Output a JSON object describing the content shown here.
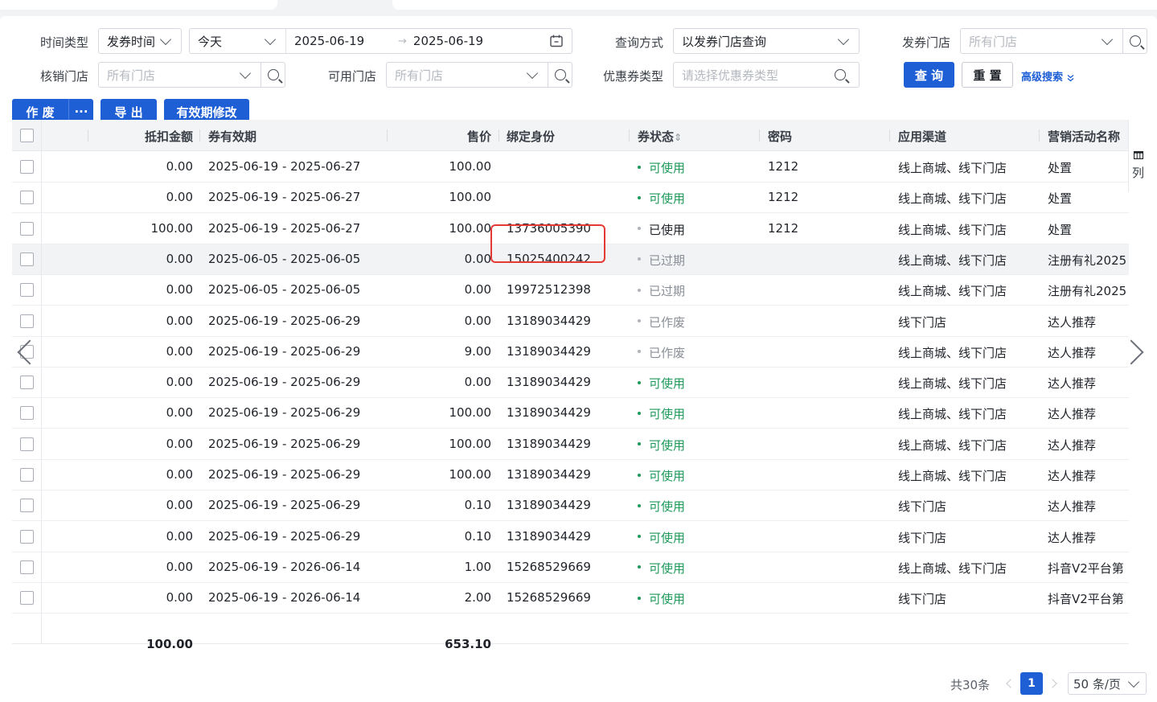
{
  "filters": {
    "time_type_label": "时间类型",
    "time_type_value": "发券时间",
    "range_value": "今天",
    "date_start": "2025-06-19",
    "date_arrow": "→",
    "date_end": "2025-06-19",
    "query_mode_label": "查询方式",
    "query_mode_value": "以发券门店查询",
    "issue_store_label": "发券门店",
    "issue_store_placeholder": "所有门店",
    "verify_store_label": "核销门店",
    "verify_store_placeholder": "所有门店",
    "usable_store_label": "可用门店",
    "usable_store_placeholder": "所有门店",
    "coupon_type_label": "优惠券类型",
    "coupon_type_placeholder": "请选择优惠券类型",
    "search_button": "查 询",
    "reset_button": "重 置",
    "advanced_link": "高级搜索"
  },
  "toolbar": {
    "void_button": "作 废",
    "more_button": "···",
    "export_button": "导 出",
    "validity_button": "有效期修改"
  },
  "table": {
    "headers": {
      "deduct": "抵扣金额",
      "validity": "券有效期",
      "price": "售价",
      "identity": "绑定身份",
      "status": "券状态",
      "sort_icon": "⇕",
      "password": "密码",
      "channel": "应用渠道",
      "campaign": "营销活动名称"
    },
    "column_settings": "列",
    "rows": [
      {
        "deduct": "0.00",
        "validity": "2025-06-19 - 2025-06-27",
        "price": "100.00",
        "identity": "",
        "status": "可使用",
        "status_kind": "ok",
        "password": "1212",
        "channel": "线上商城、线下门店",
        "campaign": "处置"
      },
      {
        "deduct": "0.00",
        "validity": "2025-06-19 - 2025-06-27",
        "price": "100.00",
        "identity": "",
        "status": "可使用",
        "status_kind": "ok",
        "password": "1212",
        "channel": "线上商城、线下门店",
        "campaign": "处置"
      },
      {
        "deduct": "100.00",
        "validity": "2025-06-19 - 2025-06-27",
        "price": "100.00",
        "identity": "13736005390",
        "status": "已使用",
        "status_kind": "used",
        "password": "1212",
        "channel": "线上商城、线下门店",
        "campaign": "处置"
      },
      {
        "deduct": "0.00",
        "validity": "2025-06-05 - 2025-06-05",
        "price": "0.00",
        "identity": "15025400242",
        "status": "已过期",
        "status_kind": "gray",
        "password": "",
        "channel": "线上商城、线下门店",
        "campaign": "注册有礼2025"
      },
      {
        "deduct": "0.00",
        "validity": "2025-06-05 - 2025-06-05",
        "price": "0.00",
        "identity": "19972512398",
        "status": "已过期",
        "status_kind": "gray",
        "password": "",
        "channel": "线上商城、线下门店",
        "campaign": "注册有礼2025"
      },
      {
        "deduct": "0.00",
        "validity": "2025-06-19 - 2025-06-29",
        "price": "0.00",
        "identity": "13189034429",
        "status": "已作废",
        "status_kind": "gray",
        "password": "",
        "channel": "线下门店",
        "campaign": "达人推荐"
      },
      {
        "deduct": "0.00",
        "validity": "2025-06-19 - 2025-06-29",
        "price": "9.00",
        "identity": "13189034429",
        "status": "已作废",
        "status_kind": "gray",
        "password": "",
        "channel": "线上商城、线下门店",
        "campaign": "达人推荐"
      },
      {
        "deduct": "0.00",
        "validity": "2025-06-19 - 2025-06-29",
        "price": "0.00",
        "identity": "13189034429",
        "status": "可使用",
        "status_kind": "ok",
        "password": "",
        "channel": "线上商城、线下门店",
        "campaign": "达人推荐"
      },
      {
        "deduct": "0.00",
        "validity": "2025-06-19 - 2025-06-29",
        "price": "100.00",
        "identity": "13189034429",
        "status": "可使用",
        "status_kind": "ok",
        "password": "",
        "channel": "线上商城、线下门店",
        "campaign": "达人推荐"
      },
      {
        "deduct": "0.00",
        "validity": "2025-06-19 - 2025-06-29",
        "price": "100.00",
        "identity": "13189034429",
        "status": "可使用",
        "status_kind": "ok",
        "password": "",
        "channel": "线上商城、线下门店",
        "campaign": "达人推荐"
      },
      {
        "deduct": "0.00",
        "validity": "2025-06-19 - 2025-06-29",
        "price": "100.00",
        "identity": "13189034429",
        "status": "可使用",
        "status_kind": "ok",
        "password": "",
        "channel": "线上商城、线下门店",
        "campaign": "达人推荐"
      },
      {
        "deduct": "0.00",
        "validity": "2025-06-19 - 2025-06-29",
        "price": "0.10",
        "identity": "13189034429",
        "status": "可使用",
        "status_kind": "ok",
        "password": "",
        "channel": "线下门店",
        "campaign": "达人推荐"
      },
      {
        "deduct": "0.00",
        "validity": "2025-06-19 - 2025-06-29",
        "price": "0.10",
        "identity": "13189034429",
        "status": "可使用",
        "status_kind": "ok",
        "password": "",
        "channel": "线下门店",
        "campaign": "达人推荐"
      },
      {
        "deduct": "0.00",
        "validity": "2025-06-19 - 2026-06-14",
        "price": "1.00",
        "identity": "15268529669",
        "status": "可使用",
        "status_kind": "ok",
        "password": "",
        "channel": "线上商城、线下门店",
        "campaign": "抖音V2平台第"
      },
      {
        "deduct": "0.00",
        "validity": "2025-06-19 - 2026-06-14",
        "price": "2.00",
        "identity": "15268529669",
        "status": "可使用",
        "status_kind": "ok",
        "password": "",
        "channel": "线下门店",
        "campaign": "抖音V2平台第"
      }
    ],
    "totals": {
      "deduct": "100.00",
      "price": "653.10"
    }
  },
  "pagination": {
    "total": "共30条",
    "current_page": "1",
    "page_size": "50 条/页"
  },
  "highlight_color": "#e53935",
  "accent_color": "#1f5fd6"
}
